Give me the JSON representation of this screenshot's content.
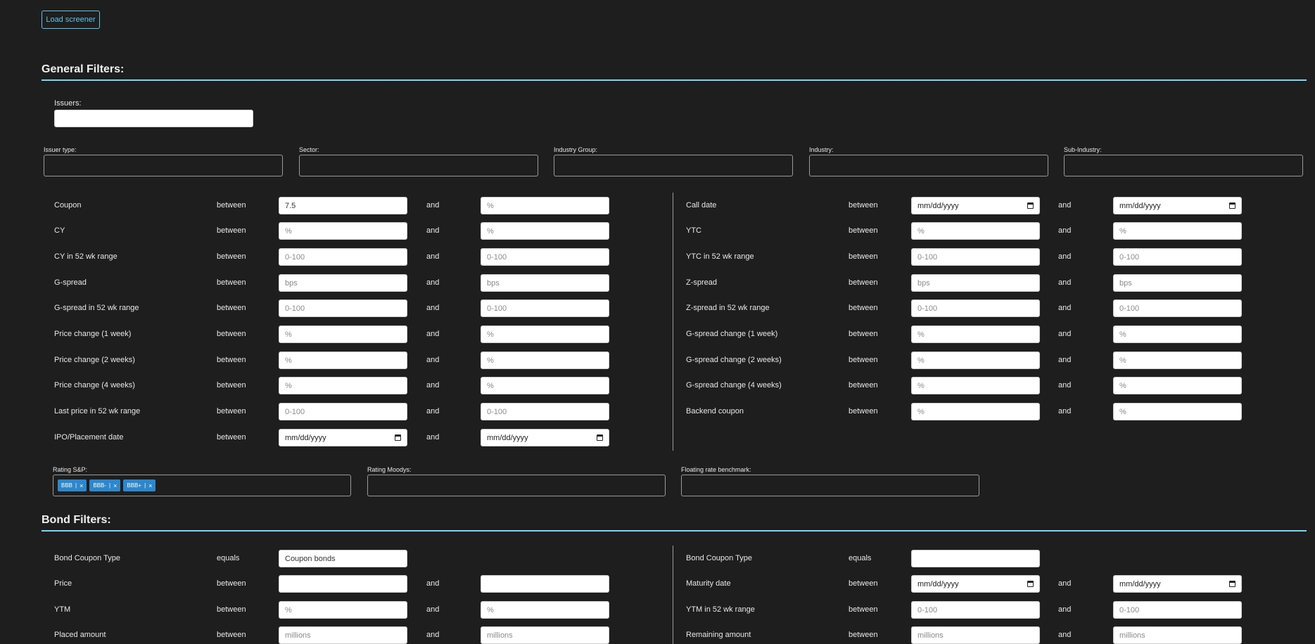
{
  "load_button": "Load screener",
  "general": {
    "title": "General Filters:",
    "issuers_label": "Issuers:",
    "dropdowns": [
      {
        "label": "Issuer type:"
      },
      {
        "label": "Sector:"
      },
      {
        "label": "Industry Group:"
      },
      {
        "label": "Industry:"
      },
      {
        "label": "Sub-Industry:"
      }
    ],
    "left_filters": [
      {
        "label": "Coupon",
        "op": "between",
        "from_value": "7.5",
        "from_ph": "",
        "and": "and",
        "to_ph": "%"
      },
      {
        "label": "CY",
        "op": "between",
        "from_ph": "%",
        "and": "and",
        "to_ph": "%"
      },
      {
        "label": "CY in 52 wk range",
        "op": "between",
        "from_ph": "0-100",
        "and": "and",
        "to_ph": "0-100"
      },
      {
        "label": "G-spread",
        "op": "between",
        "from_ph": "bps",
        "and": "and",
        "to_ph": "bps"
      },
      {
        "label": "G-spread in 52 wk range",
        "op": "between",
        "from_ph": "0-100",
        "and": "and",
        "to_ph": "0-100"
      },
      {
        "label": "Price change (1 week)",
        "op": "between",
        "from_ph": "%",
        "and": "and",
        "to_ph": "%"
      },
      {
        "label": "Price change (2 weeks)",
        "op": "between",
        "from_ph": "%",
        "and": "and",
        "to_ph": "%"
      },
      {
        "label": "Price change (4 weeks)",
        "op": "between",
        "from_ph": "%",
        "and": "and",
        "to_ph": "%"
      },
      {
        "label": "Last price in 52 wk range",
        "op": "between",
        "from_ph": "0-100",
        "and": "and",
        "to_ph": "0-100"
      },
      {
        "label": "IPO/Placement date",
        "op": "between",
        "from_date": "mm/dd/yyyy",
        "and": "and",
        "to_date": "mm/dd/yyyy"
      }
    ],
    "right_filters": [
      {
        "label": "Call date",
        "op": "between",
        "from_date": "mm/dd/yyyy",
        "and": "and",
        "to_date": "mm/dd/yyyy"
      },
      {
        "label": "YTC",
        "op": "between",
        "from_ph": "%",
        "and": "and",
        "to_ph": "%"
      },
      {
        "label": "YTC in 52 wk range",
        "op": "between",
        "from_ph": "0-100",
        "and": "and",
        "to_ph": "0-100"
      },
      {
        "label": "Z-spread",
        "op": "between",
        "from_ph": "bps",
        "and": "and",
        "to_ph": "bps"
      },
      {
        "label": "Z-spread in 52 wk range",
        "op": "between",
        "from_ph": "0-100",
        "and": "and",
        "to_ph": "0-100"
      },
      {
        "label": "G-spread change (1 week)",
        "op": "between",
        "from_ph": "%",
        "and": "and",
        "to_ph": "%"
      },
      {
        "label": "G-spread change (2 weeks)",
        "op": "between",
        "from_ph": "%",
        "and": "and",
        "to_ph": "%"
      },
      {
        "label": "G-spread change (4 weeks)",
        "op": "between",
        "from_ph": "%",
        "and": "and",
        "to_ph": "%"
      },
      {
        "label": "Backend coupon",
        "op": "between",
        "from_ph": "%",
        "and": "and",
        "to_ph": "%"
      }
    ],
    "rating_sp_label": "Rating S&P:",
    "rating_sp_tags": [
      "BBB",
      "BBB-",
      "BBB+"
    ],
    "rating_moodys_label": "Rating Moodys:",
    "floating_label": "Floating rate benchmark:"
  },
  "bond": {
    "title": "Bond Filters:",
    "left_filters": [
      {
        "label": "Bond Coupon Type",
        "op": "equals",
        "from_value": "Coupon bonds"
      },
      {
        "label": "Price",
        "op": "between",
        "from_ph": "",
        "and": "and",
        "to_ph": ""
      },
      {
        "label": "YTM",
        "op": "between",
        "from_ph": "%",
        "and": "and",
        "to_ph": "%"
      },
      {
        "label": "Placed amount",
        "op": "between",
        "from_ph": "millions",
        "and": "and",
        "to_ph": "millions"
      }
    ],
    "right_filters": [
      {
        "label": "Bond Coupon Type",
        "op": "equals",
        "from_ph": ""
      },
      {
        "label": "Maturity date",
        "op": "between",
        "from_date": "mm/dd/yyyy",
        "and": "and",
        "to_date": "mm/dd/yyyy"
      },
      {
        "label": "YTM in 52 wk range",
        "op": "between",
        "from_ph": "0-100",
        "and": "and",
        "to_ph": "0-100"
      },
      {
        "label": "Remaining amount",
        "op": "between",
        "from_ph": "millions",
        "and": "and",
        "to_ph": "millions"
      }
    ]
  },
  "colors": {
    "background": "#1e1e1e",
    "accent": "#5fc4ea",
    "tag": "#2f87c9"
  },
  "icons": {
    "calendar": "calendar-icon",
    "tag_remove": "close-icon"
  }
}
